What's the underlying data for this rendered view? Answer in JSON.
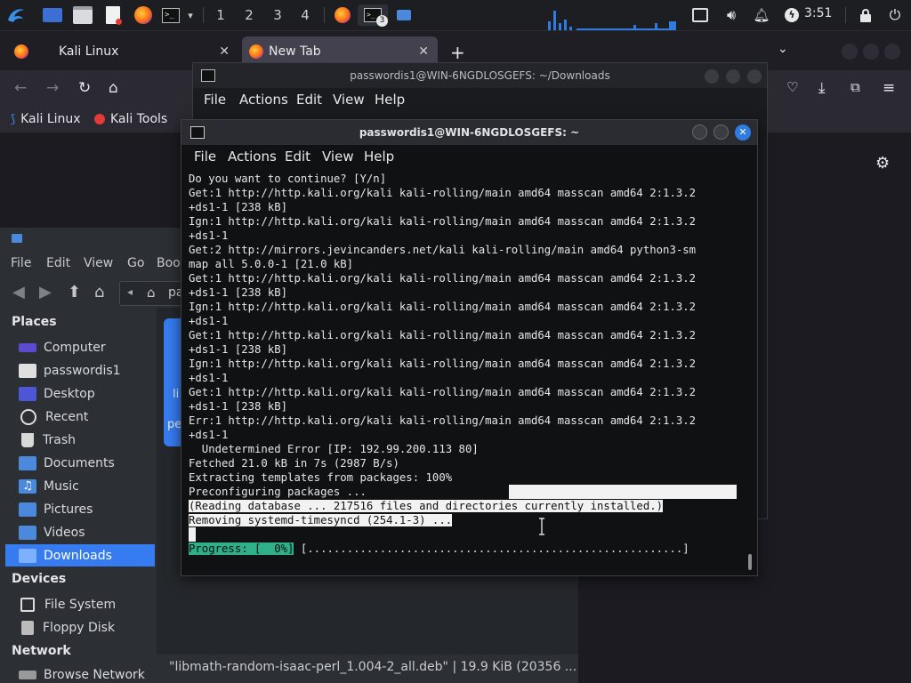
{
  "panel": {
    "workspaces": [
      "1",
      "2",
      "3",
      "4"
    ],
    "terminal_badge": "3",
    "clock": "3:51",
    "icons": [
      "kali-menu-icon",
      "desktop-icon",
      "file-manager-icon",
      "text-editor-icon",
      "firefox-icon",
      "terminal-icon",
      "dropdown-icon",
      "firefox-task-icon",
      "terminal-task-icon",
      "folder-task-icon",
      "cpu-graph-icon",
      "network-graph-icon",
      "screen-icon",
      "volume-icon",
      "bell-icon",
      "power-icon",
      "lock-icon",
      "logout-icon"
    ]
  },
  "browser": {
    "tabs": [
      {
        "label": "Kali Linux"
      },
      {
        "label": "New Tab"
      }
    ],
    "bookmarks": [
      "Kali Linux",
      "Kali Tools"
    ]
  },
  "file_manager": {
    "menu": [
      "File",
      "Edit",
      "View",
      "Go",
      "Boo"
    ],
    "path_fragment": "pa",
    "places_header": "Places",
    "places": [
      "Computer",
      "passwordis1",
      "Desktop",
      "Recent",
      "Trash",
      "Documents",
      "Music",
      "Pictures",
      "Videos",
      "Downloads"
    ],
    "devices_header": "Devices",
    "devices": [
      "File System",
      "Floppy Disk"
    ],
    "network_header": "Network",
    "network": [
      "Browse Network"
    ],
    "main_fragments": [
      "li",
      "pe"
    ],
    "status": "\"libmath-random-isaac-perl_1.004-2_all.deb\" | 19.9 KiB (20356 ..."
  },
  "term_back": {
    "title": "passwordis1@WIN-6NGDLOSGEFS: ~/Downloads",
    "menu": [
      "File",
      "Actions",
      "Edit",
      "View",
      "Help"
    ]
  },
  "term_front": {
    "title": "passwordis1@WIN-6NGDLOSGEFS: ~",
    "menu": [
      "File",
      "Actions",
      "Edit",
      "View",
      "Help"
    ],
    "lines": [
      "Do you want to continue? [Y/n]",
      "Get:1 http://http.kali.org/kali kali-rolling/main amd64 masscan amd64 2:1.3.2",
      "+ds1-1 [238 kB]",
      "Ign:1 http://http.kali.org/kali kali-rolling/main amd64 masscan amd64 2:1.3.2",
      "+ds1-1",
      "Get:2 http://mirrors.jevincanders.net/kali kali-rolling/main amd64 python3-sm",
      "map all 5.0.0-1 [21.0 kB]",
      "Get:1 http://http.kali.org/kali kali-rolling/main amd64 masscan amd64 2:1.3.2",
      "+ds1-1 [238 kB]",
      "Ign:1 http://http.kali.org/kali kali-rolling/main amd64 masscan amd64 2:1.3.2",
      "+ds1-1",
      "Get:1 http://http.kali.org/kali kali-rolling/main amd64 masscan amd64 2:1.3.2",
      "+ds1-1 [238 kB]",
      "Ign:1 http://http.kali.org/kali kali-rolling/main amd64 masscan amd64 2:1.3.2",
      "+ds1-1",
      "Get:1 http://http.kali.org/kali kali-rolling/main amd64 masscan amd64 2:1.3.2",
      "+ds1-1 [238 kB]",
      "Err:1 http://http.kali.org/kali kali-rolling/main amd64 masscan amd64 2:1.3.2",
      "+ds1-1",
      "  Undetermined Error [IP: 192.99.200.113 80]",
      "Fetched 21.0 kB in 7s (2987 B/s)",
      "Extracting templates from packages: 100%",
      "Preconfiguring packages ..."
    ],
    "highlight_lines": [
      "(Reading database ... 217516 files and directories currently installed.)",
      "Removing systemd-timesyncd (254.1-3) ..."
    ],
    "progress_label": "Progress: [  0%]",
    "progress_bar": "[.........................................................]",
    "progress_percent": 0
  }
}
